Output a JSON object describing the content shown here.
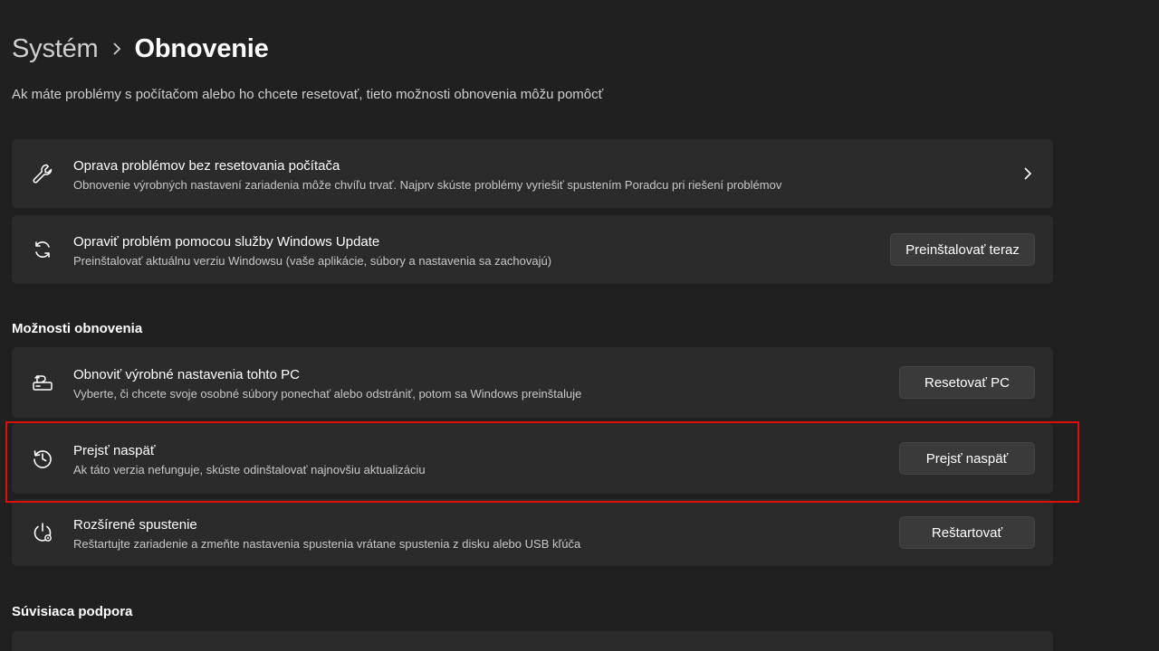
{
  "breadcrumb": {
    "parent": "Systém",
    "current": "Obnovenie"
  },
  "subtitle": "Ak máte problémy s počítačom alebo ho chcete resetovať, tieto možnosti obnovenia môžu pomôcť",
  "cards_top": [
    {
      "icon": "wrench-icon",
      "title": "Oprava problémov bez resetovania počítača",
      "desc": "Obnovenie výrobných nastavení zariadenia môže chvíľu trvať. Najprv skúste problémy vyriešiť spustením Poradcu pri riešení problémov"
    },
    {
      "icon": "sync-icon",
      "title": "Opraviť problém pomocou služby Windows Update",
      "desc": "Preinštalovať aktuálnu verziu Windowsu (vaše aplikácie, súbory a nastavenia sa zachovajú)",
      "button": "Preinštalovať teraz"
    }
  ],
  "section_recovery": "Možnosti obnovenia",
  "recovery_items": [
    {
      "icon": "reset-pc-icon",
      "title": "Obnoviť výrobné nastavenia tohto PC",
      "desc": "Vyberte, či chcete svoje osobné súbory ponechať alebo odstrániť, potom sa Windows preinštaluje",
      "button": "Resetovať PC"
    },
    {
      "icon": "history-icon",
      "title": "Prejsť naspäť",
      "desc": "Ak táto verzia nefunguje, skúste odinštalovať najnovšiu aktualizáciu",
      "button": "Prejsť naspäť"
    },
    {
      "icon": "advanced-startup-icon",
      "title": "Rozšírené spustenie",
      "desc": "Reštartujte zariadenie a zmeňte nastavenia spustenia vrátane spustenia z disku alebo USB kľúča",
      "button": "Reštartovať"
    }
  ],
  "section_support": "Súvisiaca podpora",
  "colors": {
    "background": "#202020",
    "card": "#2b2b2b",
    "highlight": "#e00d0d"
  }
}
